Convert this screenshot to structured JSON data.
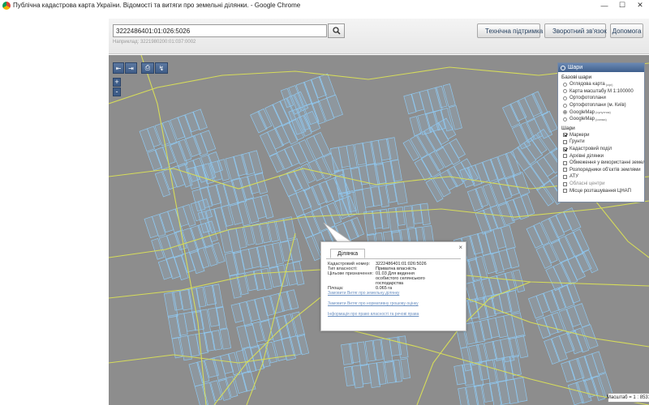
{
  "window": {
    "title": "Публічна кадастрова карта України. Відомості та витяги про земельні ділянки. - Google Chrome",
    "min_glyph": "—",
    "max_glyph": "☐",
    "close_glyph": "✕"
  },
  "search": {
    "value": "3222486401:01:026:5026",
    "hint": "Наприклад: 3221980200:01:037:0002",
    "icon": "search-icon"
  },
  "toolbar": {
    "tech_support": "Технічна підтримка",
    "feedback": "Зворотний зв'язок",
    "help": "Допомога"
  },
  "map_tools": [
    "⇤",
    "⇥",
    "⎙",
    "↯"
  ],
  "zoom": {
    "plus": "+",
    "minus": "-"
  },
  "layers_panel": {
    "title": "Шари",
    "base_heading": "Базові шари",
    "base_layers": [
      {
        "label": "Оглядова карта",
        "sup": "(сірі)",
        "selected": false
      },
      {
        "label": "Карта масштабу М 1:100000",
        "sup": "",
        "selected": false
      },
      {
        "label": "Ортофотоплани",
        "sup": "",
        "selected": false
      },
      {
        "label": "Ортофотоплани (м. Київ)",
        "sup": "",
        "selected": false
      },
      {
        "label": "GoogleMap",
        "sup": "(супутник)",
        "selected": true
      },
      {
        "label": "GoogleMap",
        "sup": "(схема)",
        "selected": false
      }
    ],
    "layers_heading": "Шари",
    "layers": [
      {
        "label": "Маркери",
        "checked": true,
        "disabled": false
      },
      {
        "label": "Ґрунти",
        "checked": false,
        "disabled": false
      },
      {
        "label": "Кадастровий поділ",
        "checked": true,
        "disabled": false
      },
      {
        "label": "Архівні ділянки",
        "checked": false,
        "disabled": false
      },
      {
        "label": "Обмеження у використанні земель",
        "checked": false,
        "disabled": false
      },
      {
        "label": "Розпорядники об'єктів землями",
        "checked": false,
        "disabled": false
      },
      {
        "label": "АТУ",
        "checked": false,
        "disabled": false
      },
      {
        "label": "Обласні центри",
        "checked": false,
        "disabled": true
      },
      {
        "label": "Місце розташування ЦНАП",
        "checked": false,
        "disabled": false
      }
    ]
  },
  "popup": {
    "tab": "Ділянка",
    "close": "×",
    "fields": [
      {
        "label": "Кадастровий номер:",
        "value": "3222486401:01:026:5026"
      },
      {
        "label": "Тип власності:",
        "value": "Приватна власність"
      },
      {
        "label": "Цільове призначення:",
        "value": "01.03 Для ведення особистого селянського господарства"
      },
      {
        "label": "Площа:",
        "value": "0.065 га"
      }
    ],
    "links": [
      "Замовити Витяг про земельну ділянку",
      "Замовити Витяг про нормативну грошову оцінку",
      "Інформація про право власності та речові права"
    ]
  },
  "scale": {
    "text": "Масштаб = 1 : 8531"
  },
  "colors": {
    "map_bg": "#8d8d8d",
    "parcel_stroke": "#8fc8f0",
    "road_stroke": "#d6dc5a",
    "accent": "#3f5f8c"
  }
}
